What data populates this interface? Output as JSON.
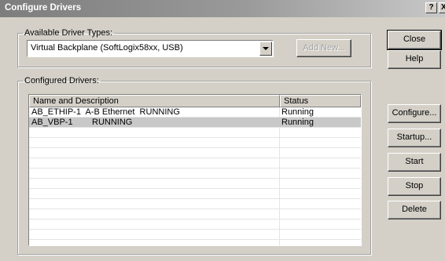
{
  "window": {
    "title": "Configure Drivers",
    "help_btn": "?",
    "close_btn": "X"
  },
  "available": {
    "group_label": "Available Driver Types:",
    "selected": "Virtual Backplane (SoftLogix58xx, USB)",
    "add_new": "Add New..."
  },
  "configured": {
    "group_label": "Configured Drivers:",
    "columns": [
      "Name and Description",
      "Status"
    ],
    "rows": [
      {
        "name": "AB_ETHIP-1  A-B Ethernet  RUNNING",
        "status": "Running"
      },
      {
        "name": "AB_VBP-1        RUNNING",
        "status": "Running"
      }
    ]
  },
  "buttons": {
    "close": "Close",
    "help": "Help",
    "configure": "Configure...",
    "startup": "Startup...",
    "start": "Start",
    "stop": "Stop",
    "delete": "Delete"
  }
}
